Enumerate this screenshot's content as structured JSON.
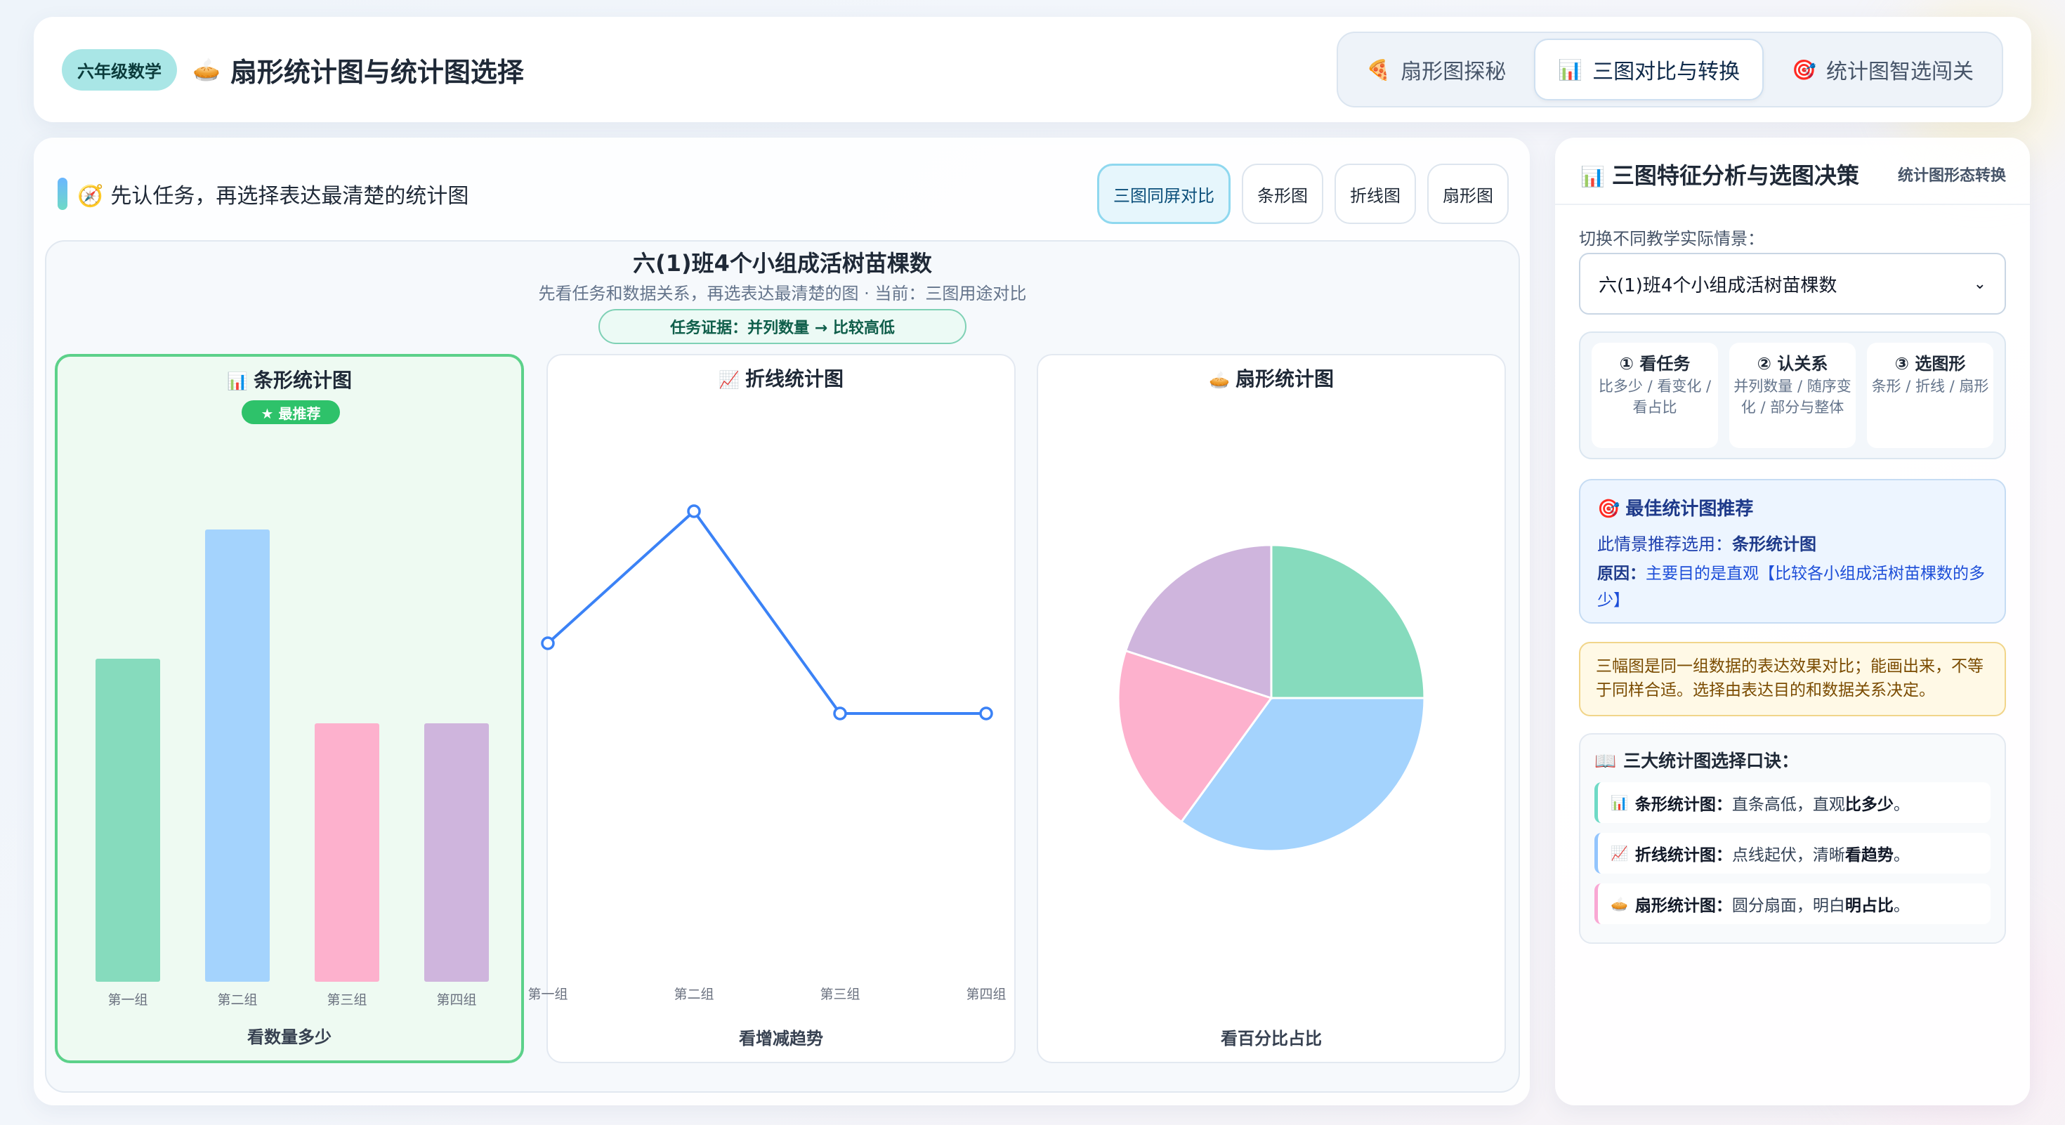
{
  "header": {
    "grade_badge": "六年级数学",
    "title_icon": "pie-icon",
    "title": "扇形统计图与统计图选择",
    "tabs": [
      {
        "icon": "pizza-icon",
        "label": "扇形图探秘",
        "active": false
      },
      {
        "icon": "bar-chart-icon",
        "label": "三图对比与转换",
        "active": true
      },
      {
        "icon": "target-icon",
        "label": "统计图智选闯关",
        "active": false
      }
    ]
  },
  "left": {
    "prompt": "先认任务，再选择表达最清楚的统计图",
    "modes": [
      "三图同屏对比",
      "条形图",
      "折线图",
      "扇形图"
    ],
    "active_mode": "三图同屏对比",
    "chart_title": "六(1)班4个小组成活树苗棵数",
    "chart_subtitle": "先看任务和数据关系，再选表达最清楚的图 · 当前：三图用途对比",
    "evidence": "任务证据：并列数量 → 比较高低",
    "cards": [
      {
        "icon": "bar-chart-icon",
        "title": "条形统计图",
        "badge": "★ 最推荐",
        "footer": "看数量多少"
      },
      {
        "icon": "line-chart-icon",
        "title": "折线统计图",
        "footer": "看增减趋势"
      },
      {
        "icon": "pie-icon",
        "title": "扇形统计图",
        "footer": "看百分比占比"
      }
    ]
  },
  "chart_data": [
    {
      "type": "bar",
      "title": "条形统计图",
      "categories": [
        "第一组",
        "第二组",
        "第三组",
        "第四组"
      ],
      "values": [
        25,
        35,
        20,
        20
      ],
      "colors": [
        "#86dbbd",
        "#a4d3fd",
        "#fdb1cd",
        "#cfb5dd"
      ],
      "ylim": [
        0,
        35
      ]
    },
    {
      "type": "line",
      "title": "折线统计图",
      "categories": [
        "第一组",
        "第二组",
        "第三组",
        "第四组"
      ],
      "values": [
        25,
        35,
        20,
        20
      ],
      "color": "#3b82f6",
      "ylim": [
        0,
        35
      ]
    },
    {
      "type": "pie",
      "title": "扇形统计图",
      "categories": [
        "第一组",
        "第二组",
        "第三组",
        "第四组"
      ],
      "values": [
        25,
        35,
        20,
        20
      ],
      "colors": [
        "#86dbbd",
        "#a4d3fd",
        "#fdb1cd",
        "#cfb5dd"
      ]
    }
  ],
  "right": {
    "title": "三图特征分析与选图决策",
    "subtitle": "统计图形态转换",
    "switch_label": "切换不同教学实际情景：",
    "scenario": "六(1)班4个小组成活树苗棵数",
    "steps": [
      {
        "head": "① 看任务",
        "desc": "比多少 / 看变化 / 看占比"
      },
      {
        "head": "② 认关系",
        "desc": "并列数量 / 随序变化 / 部分与整体"
      },
      {
        "head": "③ 选图形",
        "desc": "条形 / 折线 / 扇形"
      }
    ],
    "best": {
      "title": "最佳统计图推荐",
      "line1_prefix": "此情景推荐选用：",
      "line1_value": "条形统计图",
      "line2_prefix": "原因：",
      "line2_text": "主要目的是直观【比较各小组成活树苗棵数的多少】"
    },
    "note": "三幅图是同一组数据的表达效果对比；能画出来，不等于同样合适。选择由表达目的和数据关系决定。",
    "rhyme_title": "三大统计图选择口诀：",
    "rhymes": [
      {
        "name": "条形统计图：",
        "text": "直条高低，直观",
        "key": "比多少",
        "end": "。",
        "color": "#6fdac6"
      },
      {
        "name": "折线统计图：",
        "text": "点线起伏，清晰",
        "key": "看趋势",
        "end": "。",
        "color": "#93c5fd"
      },
      {
        "name": "扇形统计图：",
        "text": "圆分扇面，明白",
        "key": "明占比",
        "end": "。",
        "color": "#f9a8d4"
      }
    ]
  }
}
